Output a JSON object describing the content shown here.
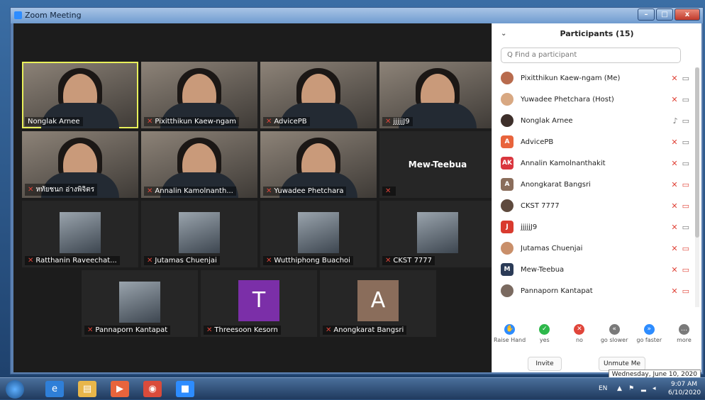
{
  "window": {
    "title": "Zoom Meeting",
    "min_label": "–",
    "max_label": "□",
    "close_label": "x"
  },
  "gallery": {
    "tiles": [
      {
        "name": "Nonglak Arnee",
        "muted": false,
        "type": "video"
      },
      {
        "name": "Pixitthikun Kaew-ngam",
        "muted": true,
        "type": "video"
      },
      {
        "name": "AdvicePB",
        "muted": true,
        "type": "video"
      },
      {
        "name": "jjjjjJ9",
        "muted": true,
        "type": "video"
      },
      {
        "name": "หทัยชนก อ่างพิจิตร",
        "muted": true,
        "type": "video"
      },
      {
        "name": "Annalin Kamolnanth...",
        "muted": true,
        "type": "video"
      },
      {
        "name": "Yuwadee Phetchara",
        "muted": true,
        "type": "video"
      },
      {
        "name": "",
        "muted": true,
        "type": "name",
        "bigname": "Mew-Teebua"
      },
      {
        "name": "Ratthanin Raveechat...",
        "muted": true,
        "type": "photo"
      },
      {
        "name": "Jutamas Chuenjai",
        "muted": true,
        "type": "photo"
      },
      {
        "name": "Wutthiphong Buachoi",
        "muted": true,
        "type": "photo"
      },
      {
        "name": "CKST 7777",
        "muted": true,
        "type": "photo"
      },
      {
        "name": "Pannaporn Kantapat",
        "muted": true,
        "type": "photo"
      },
      {
        "name": "Threesoon Kesorn",
        "muted": true,
        "type": "letter",
        "letter": "T",
        "color": "#7b2fa8"
      },
      {
        "name": "Anongkarat Bangsri",
        "muted": true,
        "type": "letter",
        "letter": "A",
        "color": "#8a6d5b"
      }
    ]
  },
  "panel": {
    "title": "Participants (15)",
    "collapse_icon": "⌄",
    "search_placeholder": "Q Find a participant",
    "participants": [
      {
        "name": "Pixitthikun Kaew-ngam (Me)",
        "avatar": "photo",
        "color": "#b86b4d",
        "mic": "off",
        "cam": "on"
      },
      {
        "name": "Yuwadee Phetchara (Host)",
        "avatar": "photo",
        "color": "#d8a882",
        "mic": "off",
        "cam": "on"
      },
      {
        "name": "Nonglak Arnee",
        "avatar": "photo",
        "color": "#3d2f2a",
        "mic": "on",
        "cam": "on"
      },
      {
        "name": "AdvicePB",
        "avatar": "A",
        "color": "#e8643c",
        "mic": "off",
        "cam": "on"
      },
      {
        "name": "Annalin Kamolnanthakit",
        "avatar": "AK",
        "color": "#d9363e",
        "mic": "off",
        "cam": "on"
      },
      {
        "name": "Anongkarat Bangsri",
        "avatar": "A",
        "color": "#8a6d5b",
        "mic": "off",
        "cam": "off"
      },
      {
        "name": "CKST 7777",
        "avatar": "photo",
        "color": "#5e4a3e",
        "mic": "off",
        "cam": "off"
      },
      {
        "name": "jjjjjJ9",
        "avatar": "J",
        "color": "#d93b2f",
        "mic": "off",
        "cam": "on"
      },
      {
        "name": "Jutamas Chuenjai",
        "avatar": "photo",
        "color": "#c98f6a",
        "mic": "off",
        "cam": "off"
      },
      {
        "name": "Mew-Teebua",
        "avatar": "M",
        "color": "#2b3b57",
        "mic": "off",
        "cam": "off"
      },
      {
        "name": "Pannaporn Kantapat",
        "avatar": "photo",
        "color": "#7a6a60",
        "mic": "off",
        "cam": "off"
      }
    ],
    "reactions": [
      {
        "label": "Raise Hand",
        "icon": "✋",
        "color": "#2d8cff"
      },
      {
        "label": "yes",
        "icon": "✓",
        "color": "#2eb84b"
      },
      {
        "label": "no",
        "icon": "✕",
        "color": "#e0453a"
      },
      {
        "label": "go slower",
        "icon": "«",
        "color": "#7a7a7a"
      },
      {
        "label": "go faster",
        "icon": "»",
        "color": "#2d8cff"
      },
      {
        "label": "more",
        "icon": "…",
        "color": "#7a7a7a"
      }
    ],
    "invite_label": "Invite",
    "unmute_label": "Unmute Me"
  },
  "taskbar": {
    "apps": [
      {
        "name": "ie",
        "icon": "e",
        "color": "#2f7fd8"
      },
      {
        "name": "explorer",
        "icon": "▤",
        "color": "#e8b64a"
      },
      {
        "name": "media",
        "icon": "▶",
        "color": "#e8643c"
      },
      {
        "name": "chrome",
        "icon": "◉",
        "color": "#d94b3b"
      },
      {
        "name": "zoom",
        "icon": "■",
        "color": "#2d8cff"
      }
    ],
    "lang": "EN",
    "time": "9:07 AM",
    "date": "6/10/2020",
    "date_tooltip": "Wednesday, June 10, 2020"
  }
}
